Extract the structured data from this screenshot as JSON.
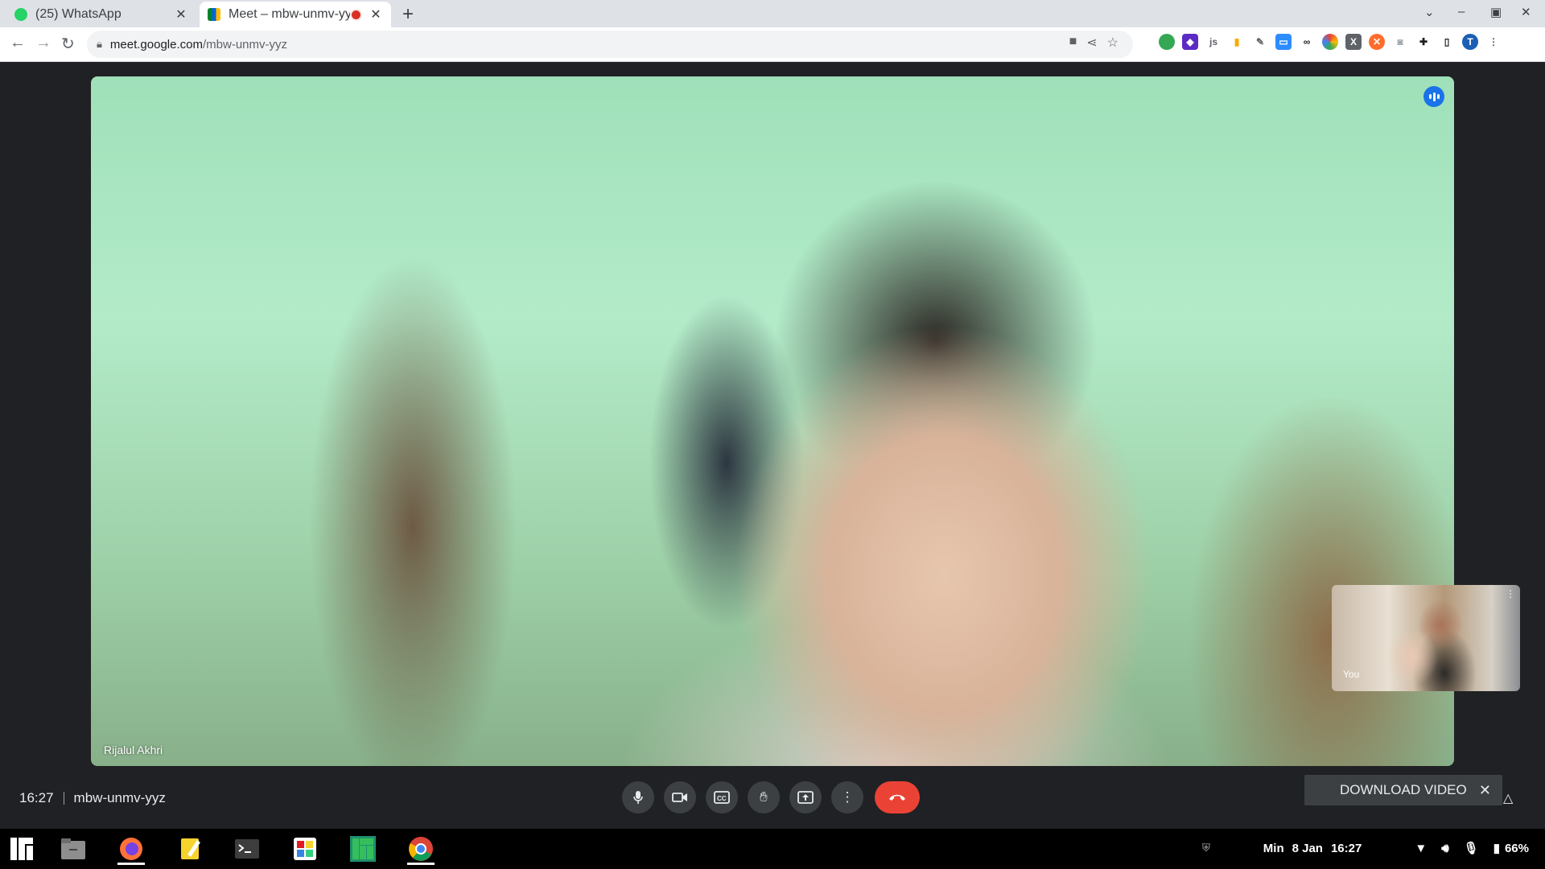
{
  "browser": {
    "tabs": [
      {
        "title": "(25) WhatsApp",
        "icon": "whatsapp-icon",
        "active": false
      },
      {
        "title": "Meet – mbw-unmv-yy",
        "icon": "google-meet-icon",
        "active": true,
        "recording": true
      }
    ],
    "url_domain": "meet.google.com",
    "url_path": "/mbw-unmv-yyz",
    "extensions": [
      "green-shield-icon",
      "purple-extension-icon",
      "js-icon",
      "chart-icon",
      "pen-icon",
      "zoom-icon",
      "glasses-icon",
      "color-wheel-icon",
      "x-icon",
      "orange-extension-icon",
      "camera-icon",
      "puzzle-icon",
      "sidebar-icon",
      "profile-icon"
    ]
  },
  "meeting": {
    "participant_name": "Rijalul Akhri",
    "self_label": "You",
    "time": "16:27",
    "code": "mbw-unmv-yyz"
  },
  "controls": [
    "microphone-icon",
    "camera-icon",
    "captions-icon",
    "raise-hand-icon",
    "present-icon",
    "more-options-icon",
    "end-call-icon"
  ],
  "download_popup": {
    "label": "DOWNLOAD VIDEO",
    "close": "✕"
  },
  "taskbar": {
    "apps": [
      "manjaro-menu-icon",
      "files-icon",
      "firefox-icon",
      "notes-icon",
      "terminal-icon",
      "software-store-icon",
      "manjaro-icon",
      "chrome-icon"
    ],
    "day": "Min",
    "date": "8 Jan",
    "clock": "16:27",
    "battery": "66%"
  },
  "colors": {
    "meet_bg": "#202124",
    "end_call": "#ea4335",
    "speaking": "#1a73e8"
  }
}
